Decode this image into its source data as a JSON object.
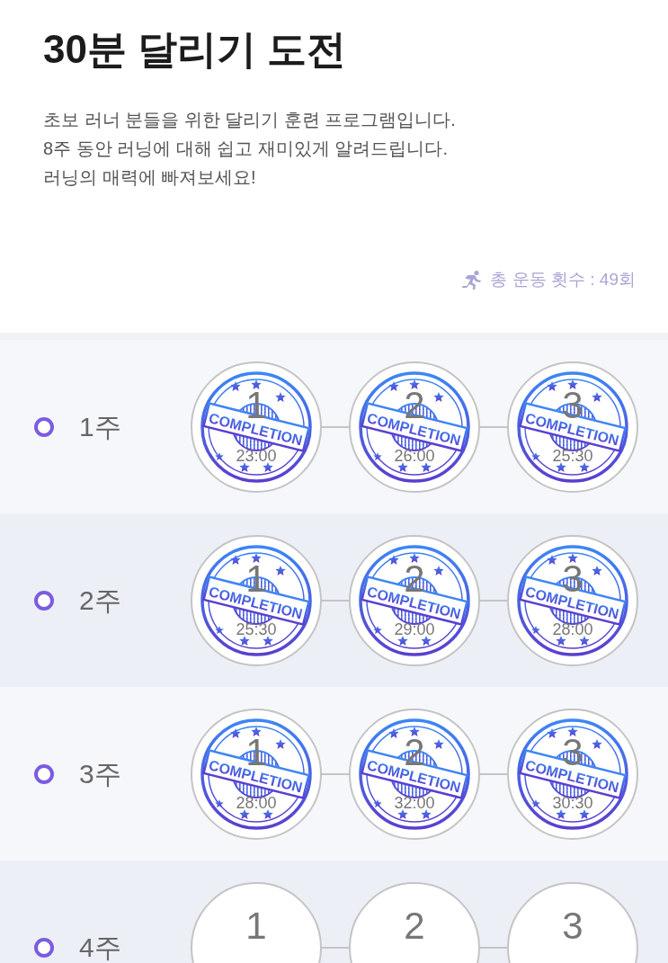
{
  "header": {
    "title": "30분 달리기 도전",
    "description": "초보 러너 분들을 위한 달리기 훈련 프로그램입니다.\n8주 동안 러닝에 대해 쉽고 재미있게 알려드립니다.\n러닝의 매력에 빠져보세요!",
    "total": "총 운동 횟수 : 49회"
  },
  "weeks": [
    {
      "label": "1주",
      "sessions": [
        {
          "number": "1",
          "time": "23:00",
          "stamp": "COMPLETION"
        },
        {
          "number": "2",
          "time": "26:00",
          "stamp": "COMPLETION"
        },
        {
          "number": "3",
          "time": "25:30",
          "stamp": "COMPLETION"
        }
      ]
    },
    {
      "label": "2주",
      "sessions": [
        {
          "number": "1",
          "time": "25:30",
          "stamp": "COMPLETION"
        },
        {
          "number": "2",
          "time": "29:00",
          "stamp": "COMPLETION"
        },
        {
          "number": "3",
          "time": "28:00",
          "stamp": "COMPLETION"
        }
      ]
    },
    {
      "label": "3주",
      "sessions": [
        {
          "number": "1",
          "time": "28:00",
          "stamp": "COMPLETION"
        },
        {
          "number": "2",
          "time": "32:00",
          "stamp": "COMPLETION"
        },
        {
          "number": "3",
          "time": "30:30",
          "stamp": "COMPLETION"
        }
      ]
    },
    {
      "label": "4주",
      "sessions": [
        {
          "number": "1"
        },
        {
          "number": "2"
        },
        {
          "number": "3"
        }
      ]
    }
  ]
}
